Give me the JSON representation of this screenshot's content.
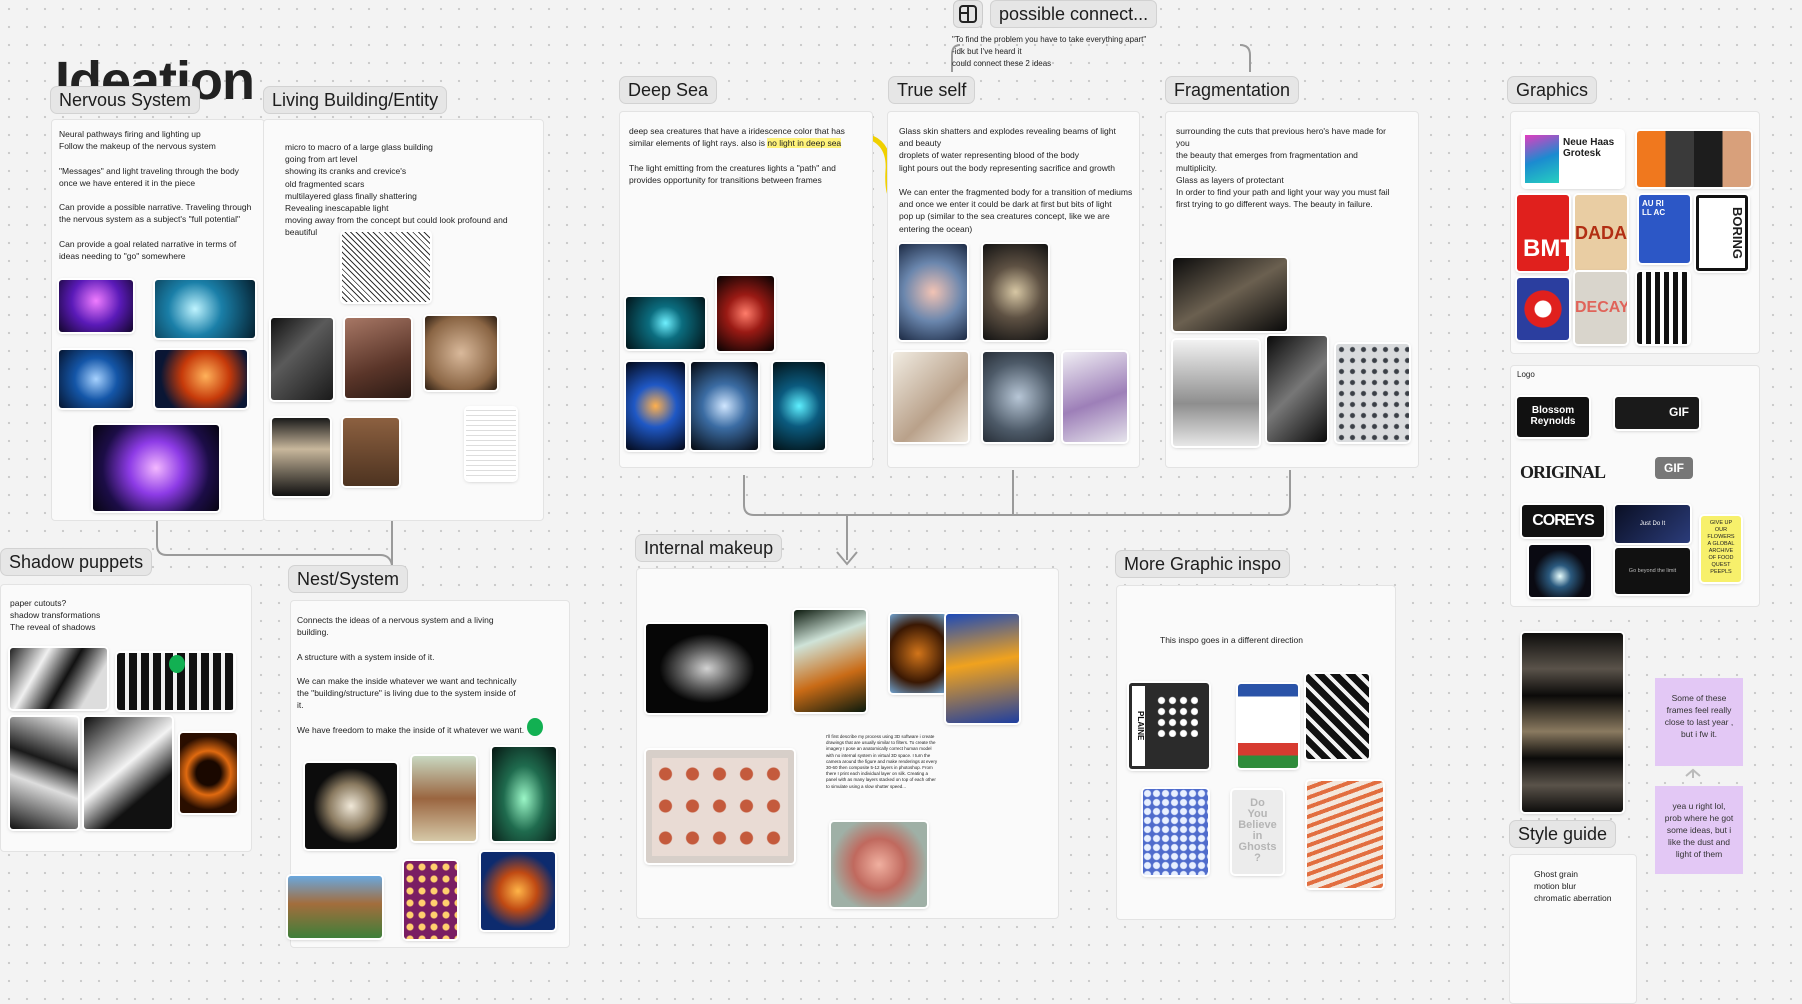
{
  "colors": {
    "canvas": "#f3f3f3",
    "section": "#fafafa",
    "label": "#e6e6e6",
    "highlight": "#fff37a",
    "sticky": "#e3c8f5",
    "connector": "#9a9a9a"
  },
  "page_title": "Ideation",
  "toolbar": {
    "icon": "layout-icon",
    "title": "possible connect..."
  },
  "floating_quote": {
    "line1": "\"To find the problem you have to take everything apart\"",
    "line2": "-idk but I've heard it",
    "line3": "could connect these 2 ideas"
  },
  "sections": {
    "nervous": {
      "label": "Nervous System",
      "note": "Neural pathways firing and lighting up\nFollow the makeup of the nervous system\n\n\"Messages\" and light traveling through the body\nonce we have entered it in the piece\n\nCan provide a possible narrative. Traveling through\nthe nervous system as a subject's \"full potential\"\n\nCan provide a goal related narrative in terms of\nideas needing to \"go\" somewhere"
    },
    "living": {
      "label": "Living Building/Entity",
      "note": "micro to macro of a large glass building\ngoing from art level\nshowing its cranks and crevice's\nold fragmented scars\nmultilayered glass finally shattering\nRevealing inescapable light\nmoving away from the concept but could look profound and\nbeautiful"
    },
    "deep_sea": {
      "label": "Deep Sea",
      "note_a": "deep sea creatures that have a iridescence color that has\nsimilar elements of light rays. also is ",
      "note_hl": "no light in deep sea",
      "note_b": "The light emitting from the creatures lights a \"path\" and\nprovides opportunity for transitions between frames"
    },
    "true_self": {
      "label": "True self",
      "note": "Glass skin shatters and explodes revealing beams of light\nand beauty\ndroplets of water representing blood of the body\nlight pours out the body representing sacrifice and growth\n\nWe can enter the fragmented body for a transition of mediums\nand once we enter it could be dark at first but bits of light\npop up (similar to the sea creatures concept, like we are\nentering the ocean)"
    },
    "fragmentation": {
      "label": "Fragmentation",
      "note": "surrounding the cuts that previous hero's have made for\nyou\nthe beauty that emerges from fragmentation and\nmultiplicity.\nGlass as layers of protectant\nIn order to find your path and light your way you must fail\nfirst trying to go different ways. The beauty in failure."
    },
    "graphics": {
      "label": "Graphics",
      "poster_text": "Neue Haas\nGrotesk",
      "p_dada": "DADA",
      "p_boring": "BORING",
      "p_decay": "DECAY",
      "p_bmt": "BMT",
      "p_au": "AU     RI\nLL   AC"
    },
    "logo": {
      "title": "Logo",
      "gif": "GIF",
      "gif2": "GIF",
      "blossom": "Blossom\nReynolds",
      "original": "ORIGINAL",
      "coreys": "COREYS",
      "just": "Just Do It",
      "beyond": "Go beyond the limit",
      "yellow": "GIVE UP\nOUR\nFLOWERS\nA GLOBAL\nARCHIVE\nOF FOOD\nQUEST\nPEEPLS"
    },
    "shadow": {
      "label": "Shadow puppets",
      "note": "paper cutouts?\nshadow transformations\nThe reveal of shadows"
    },
    "nest": {
      "label": "Nest/System",
      "note": "Connects the ideas of a nervous system and a living\nbuilding.\n\nA structure with a system inside of it.\n\nWe can make the inside whatever we want and technically\nthe \"building/structure\" is living due to the system inside of\nit.\n\nWe have freedom to make the inside of it whatever we want."
    },
    "internal": {
      "label": "Internal makeup",
      "caption": "I'll first describe my process using 3D software i create drawings that are usually similar to filters. To create the imagery I pose an anatomically correct human model with no internal system in virtual 3D space. I turn the camera around the figure and make renderings at every 30-60 then composite 5-12 layers in photoshop. From there I print each individual layer on silk. Creating a panel with as many layers stacked on top of each other to simulate using a slow shutter speed..."
    },
    "more_graphic": {
      "label": "More Graphic inspo",
      "note": "This inspo goes in a different direction",
      "plaine": "PLAINE",
      "ghost": "Do\nYou\nBelieve\nin\nGhosts\n?"
    },
    "style": {
      "label": "Style guide",
      "note": "Ghost grain\nmotion blur\nchromatic aberration"
    }
  },
  "stickies": [
    {
      "text": "Some of these frames feel really close to last year , but i fw it."
    },
    {
      "text": "yea u right lol, prob where he got some ideas, but i like the dust and light of them"
    }
  ]
}
